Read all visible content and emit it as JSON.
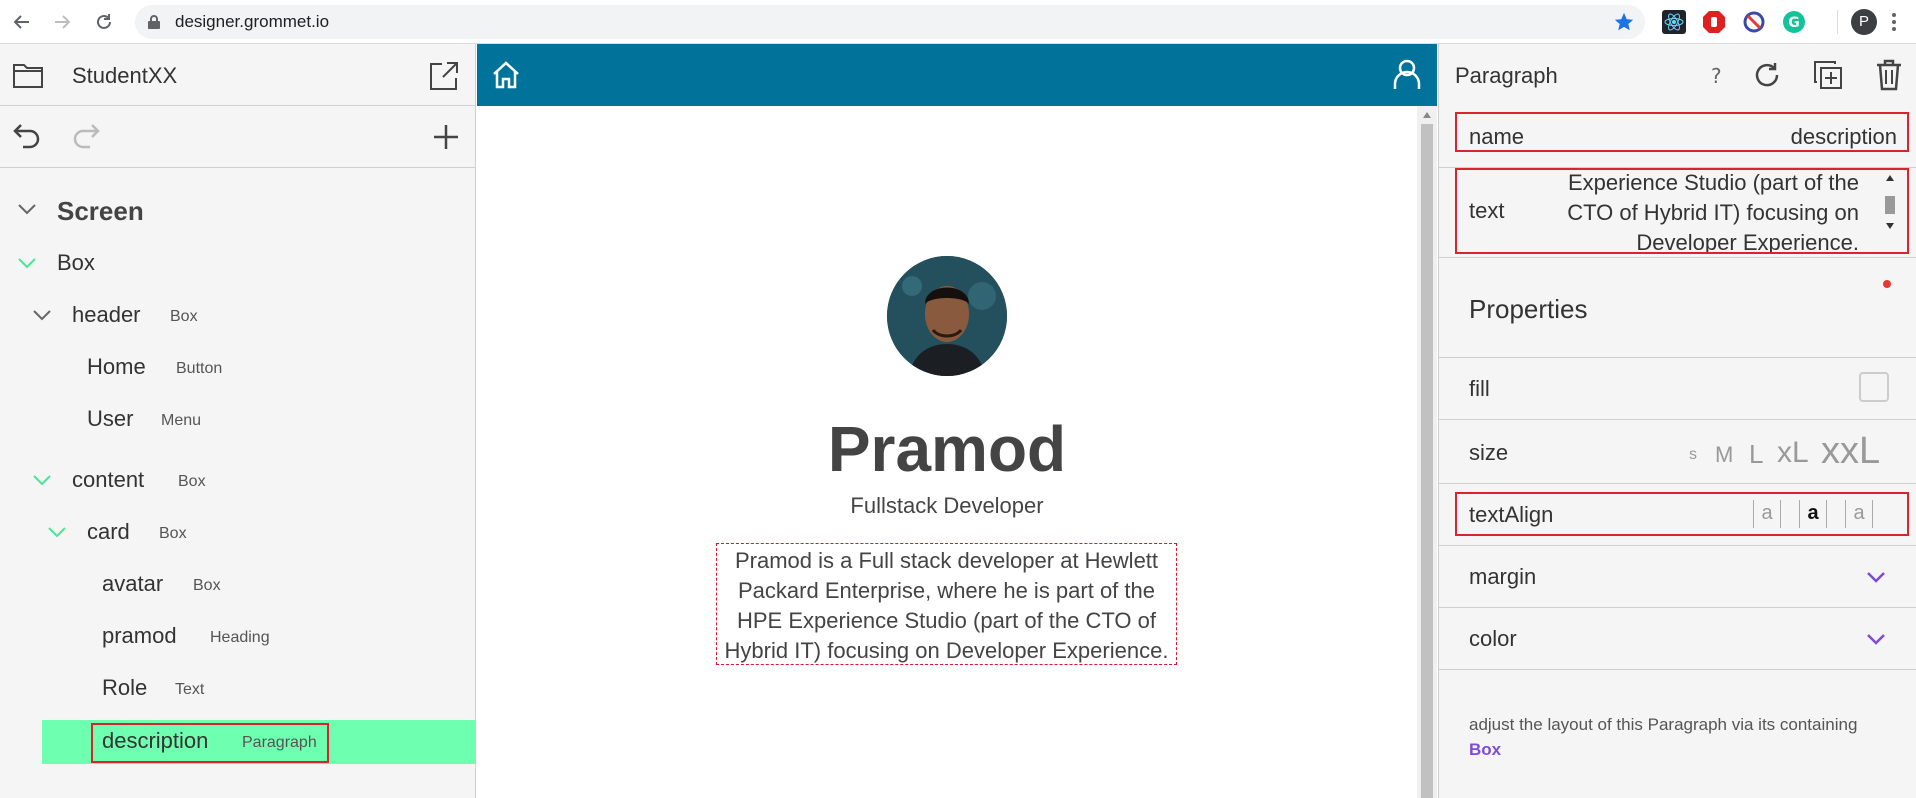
{
  "browser": {
    "url": "designer.grommet.io",
    "profile_initial": "P"
  },
  "left_panel": {
    "title": "StudentXX",
    "tree": [
      {
        "label": "Screen",
        "type": ""
      },
      {
        "label": "Box",
        "type": ""
      },
      {
        "label": "header",
        "type": "Box"
      },
      {
        "label": "Home",
        "type": "Button"
      },
      {
        "label": "User",
        "type": "Menu"
      },
      {
        "label": "content",
        "type": "Box"
      },
      {
        "label": "card",
        "type": "Box"
      },
      {
        "label": "avatar",
        "type": "Box"
      },
      {
        "label": "pramod",
        "type": "Heading"
      },
      {
        "label": "Role",
        "type": "Text"
      },
      {
        "label": "description",
        "type": "Paragraph"
      }
    ]
  },
  "canvas": {
    "name": "Pramod",
    "role": "Fullstack Developer",
    "description": "Pramod is a Full stack developer at Hewlett Packard Enterprise, where he is part of the HPE Experience Studio (part of the CTO of Hybrid IT) focusing on Developer Experience."
  },
  "right_panel": {
    "title": "Paragraph",
    "help": "?",
    "name_label": "name",
    "name_value": "description",
    "text_label": "text",
    "text_value": "Experience Studio (part of the CTO of Hybrid IT) focusing on Developer Experience.",
    "properties_title": "Properties",
    "fill_label": "fill",
    "size_label": "size",
    "size_options": [
      "s",
      "M",
      "L",
      "xL",
      "xxL"
    ],
    "textalign_label": "textAlign",
    "align_options": [
      "a",
      "a",
      "a"
    ],
    "margin_label": "margin",
    "color_label": "color",
    "note_text": "adjust the layout of this Paragraph via its containing",
    "note_link": "Box"
  },
  "colors": {
    "header_blue": "#01739b",
    "selected_green": "#6fffb0",
    "highlight_red": "#d9232d",
    "accent_purple": "#7d4cdb"
  }
}
